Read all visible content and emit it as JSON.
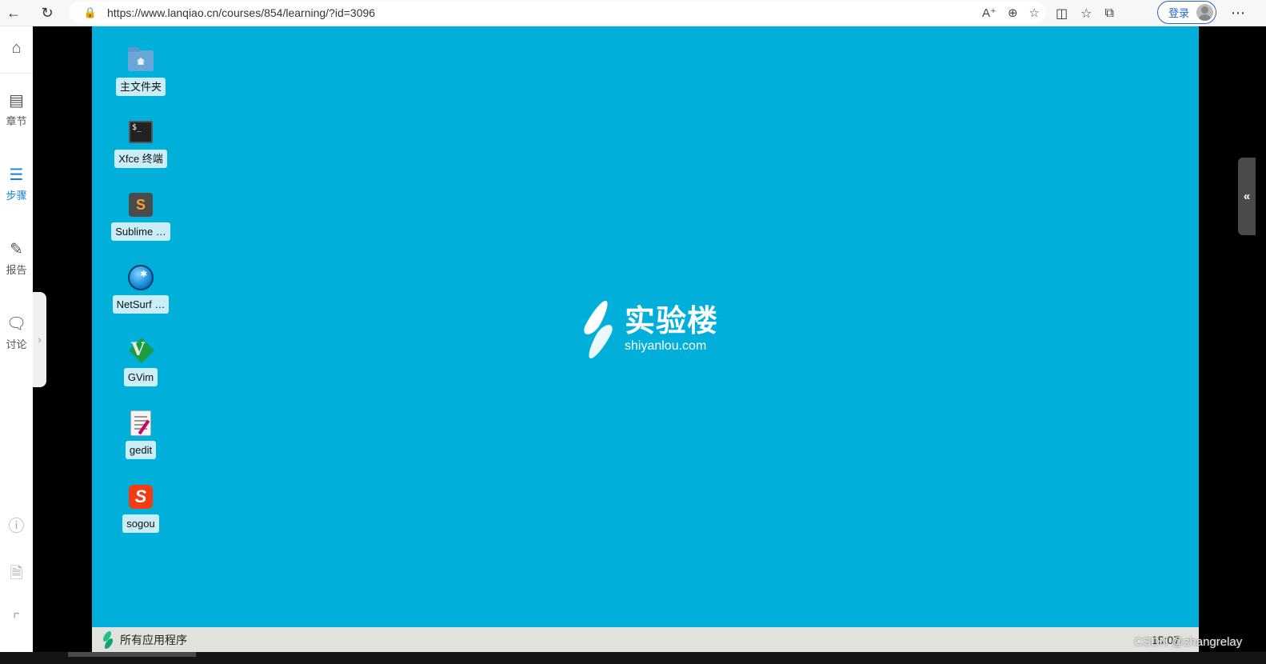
{
  "browser": {
    "url": "https://www.lanqiao.cn/courses/854/learning/?id=3096",
    "login_label": "登录"
  },
  "sidebar": {
    "items": [
      {
        "label": "",
        "icon": "home-icon"
      },
      {
        "label": "章节",
        "icon": "chapters-icon"
      },
      {
        "label": "步骤",
        "icon": "steps-icon"
      },
      {
        "label": "报告",
        "icon": "report-icon"
      },
      {
        "label": "讨论",
        "icon": "discussion-icon"
      }
    ],
    "bottom_icons": [
      "help-icon",
      "document-close-icon",
      "stairs-icon"
    ],
    "active_color": "#1b7fe0"
  },
  "desktop": {
    "background": "#00b0db",
    "icons": [
      {
        "label": "主文件夹",
        "icon": "home-folder-icon"
      },
      {
        "label": "Xfce 终端",
        "icon": "terminal-icon"
      },
      {
        "label": "Sublime …",
        "icon": "sublime-icon"
      },
      {
        "label": "NetSurf …",
        "icon": "netsurf-icon"
      },
      {
        "label": "GVim",
        "icon": "gvim-icon"
      },
      {
        "label": "gedit",
        "icon": "gedit-icon"
      },
      {
        "label": "sogou",
        "icon": "sogou-icon"
      }
    ],
    "logo": {
      "cn": "实验楼",
      "en": "shiyanlou.com"
    },
    "taskbar": {
      "apps_label": "所有应用程序",
      "clock": "15:07"
    }
  },
  "watermark": "CSDN @zhangrelay"
}
